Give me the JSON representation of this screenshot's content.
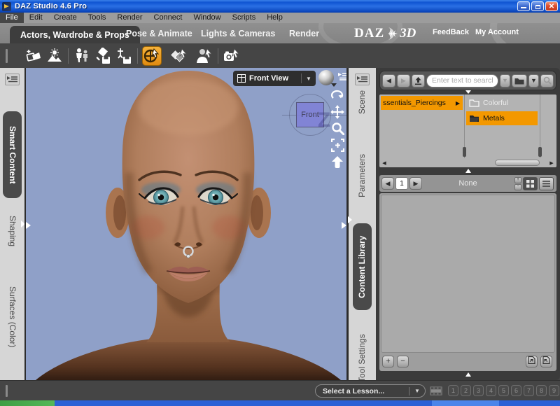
{
  "window": {
    "title": "DAZ Studio 4.6 Pro"
  },
  "menubar": {
    "items": [
      "File",
      "Edit",
      "Create",
      "Tools",
      "Render",
      "Connect",
      "Window",
      "Scripts",
      "Help"
    ]
  },
  "tabbar": {
    "tabs": [
      "Actors, Wardrobe & Props",
      "Pose & Animate",
      "Lights & Cameras",
      "Render"
    ],
    "active_tab": "Actors, Wardrobe & Props",
    "logo_daz": "DAZ",
    "logo_3d": "3D",
    "feedback": "FeedBack",
    "my_account": "My Account"
  },
  "toolbar": {
    "icons": [
      "add-content",
      "render-preview",
      "manage-figures",
      "save-wearables",
      "save-file",
      "node-selection-tool",
      "surface-selection-tool",
      "figure-selection-tool",
      "camera-selection-tool"
    ],
    "active_tool": "node-selection-tool"
  },
  "left_dock": {
    "tabs": [
      "Smart Content",
      "Shaping",
      "Surfaces (Color)"
    ],
    "active": "Smart Content"
  },
  "viewport": {
    "view_selector": "Front View",
    "gizmo_label": "Front",
    "gizmo_axis": "Z"
  },
  "right_dock": {
    "tabs": [
      "Scene",
      "Parameters",
      "Content Library",
      "Tool Settings"
    ],
    "active": "Content Library"
  },
  "content_library": {
    "search_placeholder": "Enter text to search by...",
    "selected_category": "ssentials_Piercings",
    "subfolders": [
      {
        "label": "Colorful",
        "selected": false
      },
      {
        "label": "Metals",
        "selected": true
      }
    ],
    "page_number": "1",
    "selection_label": "None"
  },
  "lesson_bar": {
    "dropdown_label": "Select a Lesson...",
    "lesson_numbers": [
      "1",
      "2",
      "3",
      "4",
      "5",
      "6",
      "7",
      "8",
      "9"
    ]
  },
  "colors": {
    "selection_orange": "#f39800",
    "xp_blue": "#2a64d8",
    "viewport_bg": "#8fa0c8"
  }
}
